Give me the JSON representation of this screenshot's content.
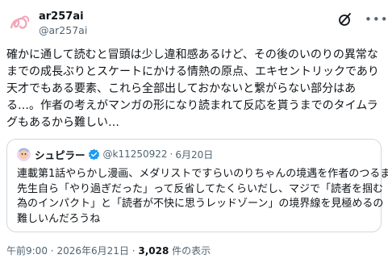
{
  "post": {
    "author": {
      "display_name": "ar257ai",
      "handle": "@ar257ai",
      "avatar_icon": "pink-swirl-avatar"
    },
    "body_lines": [
      "確かに通して読むと冒頭は少し違和感あるけど、その後のいのりの異常な",
      "までの成長ぶりとスケートにかける情熱の原点、エキセントリックであり",
      "天才でもある要素、これら全部出しておかないと繋がらない部分はあ",
      "る…。作者の考えがマンガの形になり読まれて反応を貰うまでのタイムラ",
      "グもあるから難しい…"
    ],
    "quote": {
      "display_name": "シュピラー",
      "handle": "@k11250922",
      "separator": "·",
      "date": "6月20日",
      "verified_color": "#1d9bf0",
      "lines": [
        "連載第1話やらかし漫画、メダリストですらいのりちゃんの境遇を作者のつるま",
        "先生自ら「やり過ぎだった」って反省してたくらいだし、マジで「読者を掴む",
        "為のインパクト」と「読者が不快に思うレッドゾーン」の境界線を見極めるの",
        "難しいんだろうね"
      ]
    },
    "footer": {
      "time": "午前9:00",
      "separator1": "·",
      "date": "2026年6月21日",
      "separator2": "·",
      "views_count": "3,028",
      "views_label": "件の表示"
    }
  },
  "colors": {
    "text_primary": "#0f1419",
    "text_secondary": "#536471",
    "border": "#cfd9de",
    "avatar_pink": "#f4a6b8"
  }
}
